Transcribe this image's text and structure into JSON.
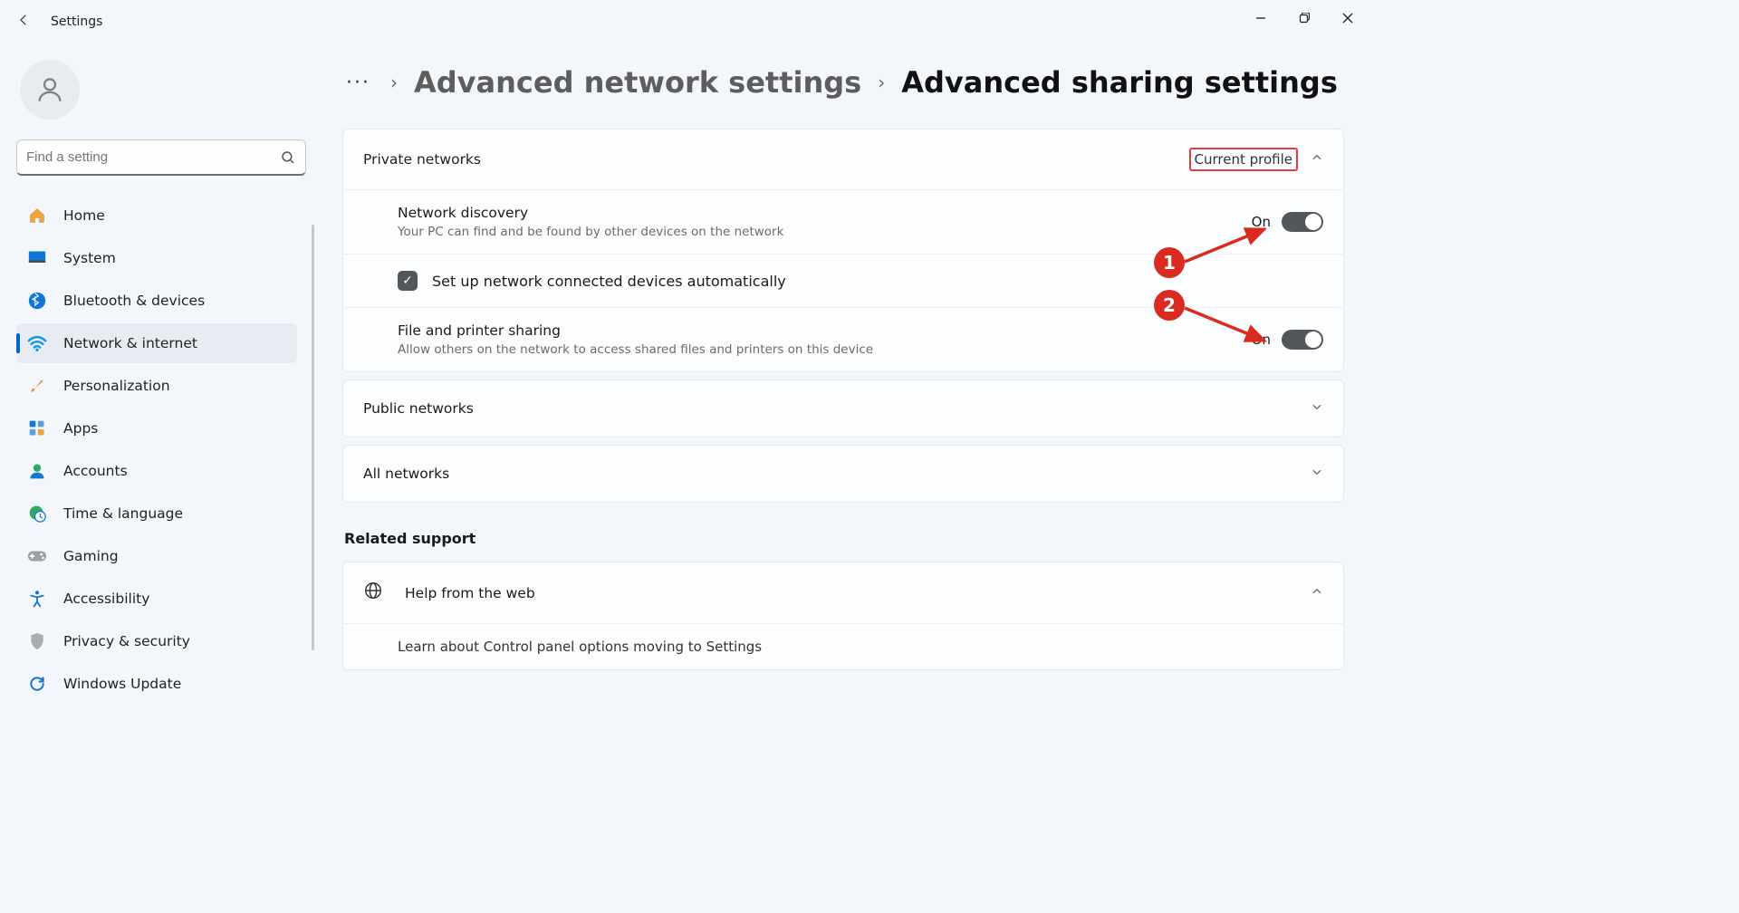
{
  "window": {
    "title": "Settings"
  },
  "search": {
    "placeholder": "Find a setting"
  },
  "nav": {
    "home": "Home",
    "system": "System",
    "bluetooth": "Bluetooth & devices",
    "network": "Network & internet",
    "personalization": "Personalization",
    "apps": "Apps",
    "accounts": "Accounts",
    "time": "Time & language",
    "gaming": "Gaming",
    "accessibility": "Accessibility",
    "privacy": "Privacy & security",
    "update": "Windows Update"
  },
  "breadcrumb": {
    "parent": "Advanced network settings",
    "current": "Advanced sharing settings"
  },
  "private": {
    "heading": "Private networks",
    "badge": "Current profile",
    "discovery_title": "Network discovery",
    "discovery_sub": "Your PC can find and be found by other devices on the network",
    "discovery_state": "On",
    "auto_setup": "Set up network connected devices automatically",
    "fps_title": "File and printer sharing",
    "fps_sub": "Allow others on the network to access shared files and printers on this device",
    "fps_state": "On"
  },
  "public": {
    "heading": "Public networks"
  },
  "all": {
    "heading": "All networks"
  },
  "related": {
    "heading": "Related support",
    "help_title": "Help from the web",
    "help_link1": "Learn about Control panel options moving to Settings"
  },
  "annotations": {
    "a1": "1",
    "a2": "2"
  }
}
